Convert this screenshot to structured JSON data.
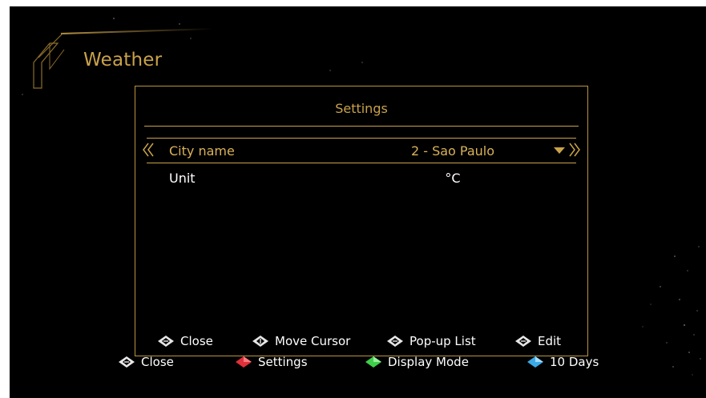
{
  "app": {
    "title": "Weather"
  },
  "dialog": {
    "title": "Settings",
    "rows": [
      {
        "label": "City name",
        "value": "2 - Sao Paulo",
        "selected": true
      },
      {
        "label": "Unit",
        "value": "°C",
        "selected": false
      }
    ],
    "hints": [
      {
        "key": "ok-key-icon",
        "label": "Close"
      },
      {
        "key": "updown-key-icon",
        "label": "Move Cursor"
      },
      {
        "key": "ok-key-icon",
        "label": "Pop-up List"
      },
      {
        "key": "ok-key-icon",
        "label": "Edit"
      }
    ]
  },
  "footer": {
    "hints": [
      {
        "key": "exit-key-icon",
        "color": "#e8e8e8",
        "label": "Close"
      },
      {
        "key": "red-key-icon",
        "color": "#e0303a",
        "label": "Settings"
      },
      {
        "key": "green-key-icon",
        "color": "#3fcf4a",
        "label": "Display Mode"
      },
      {
        "key": "blue-key-icon",
        "color": "#3aa9e8",
        "label": "10 Days"
      }
    ]
  },
  "colors": {
    "accent": "#c9a24a",
    "background": "#000000",
    "text": "#ffffff"
  }
}
